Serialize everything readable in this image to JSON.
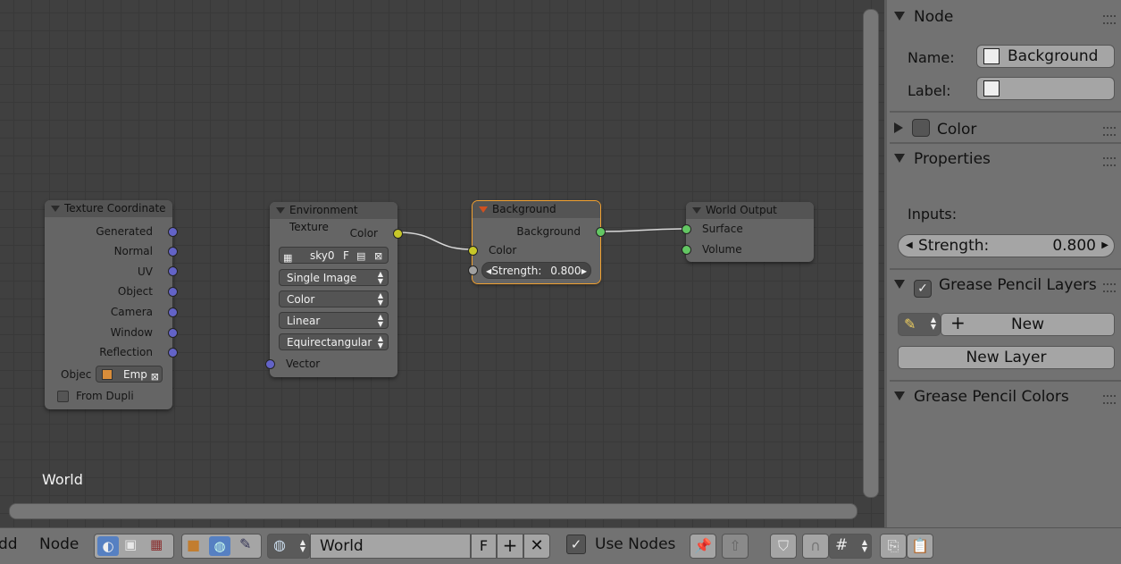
{
  "editor": {
    "tree_name": "World",
    "nodes": {
      "texture_coordinate": {
        "title": "Texture Coordinate",
        "outputs": [
          "Generated",
          "Normal",
          "UV",
          "Object",
          "Camera",
          "Window",
          "Reflection"
        ],
        "object_label": "Objec",
        "object_value": "Emp",
        "from_dupli": "From Dupli"
      },
      "environment_texture": {
        "title": "Environment Texture",
        "output": "Color",
        "image_name": "sky0",
        "fake_user": "F",
        "source": "Single Image",
        "color_space": "Color",
        "interpolation": "Linear",
        "projection": "Equirectangular",
        "input": "Vector"
      },
      "background": {
        "title": "Background",
        "output": "Background",
        "input_color": "Color",
        "strength_label": "Strength:",
        "strength_value": "0.800"
      },
      "world_output": {
        "title": "World Output",
        "inputs": [
          "Surface",
          "Volume"
        ]
      }
    }
  },
  "sidebar": {
    "node_panel": {
      "title": "Node",
      "name_label": "Name:",
      "name_value": "Background",
      "label_label": "Label:",
      "label_value": ""
    },
    "color_panel": {
      "title": "Color"
    },
    "properties_panel": {
      "title": "Properties",
      "inputs_label": "Inputs:",
      "strength_label": "Strength:",
      "strength_value": "0.800"
    },
    "grease_layers_panel": {
      "title": "Grease Pencil Layers",
      "new_label": "New",
      "new_layer_label": "New Layer"
    },
    "grease_colors_panel": {
      "title": "Grease Pencil Colors"
    }
  },
  "header": {
    "menu_add": "dd",
    "menu_node": "Node",
    "world_name": "World",
    "fake_user": "F",
    "use_nodes_label": "Use Nodes"
  },
  "colors": {
    "active_outline": "#f0a030",
    "socket_shader": "#63c763",
    "socket_color": "#c7c729",
    "socket_vector": "#6363c7"
  }
}
